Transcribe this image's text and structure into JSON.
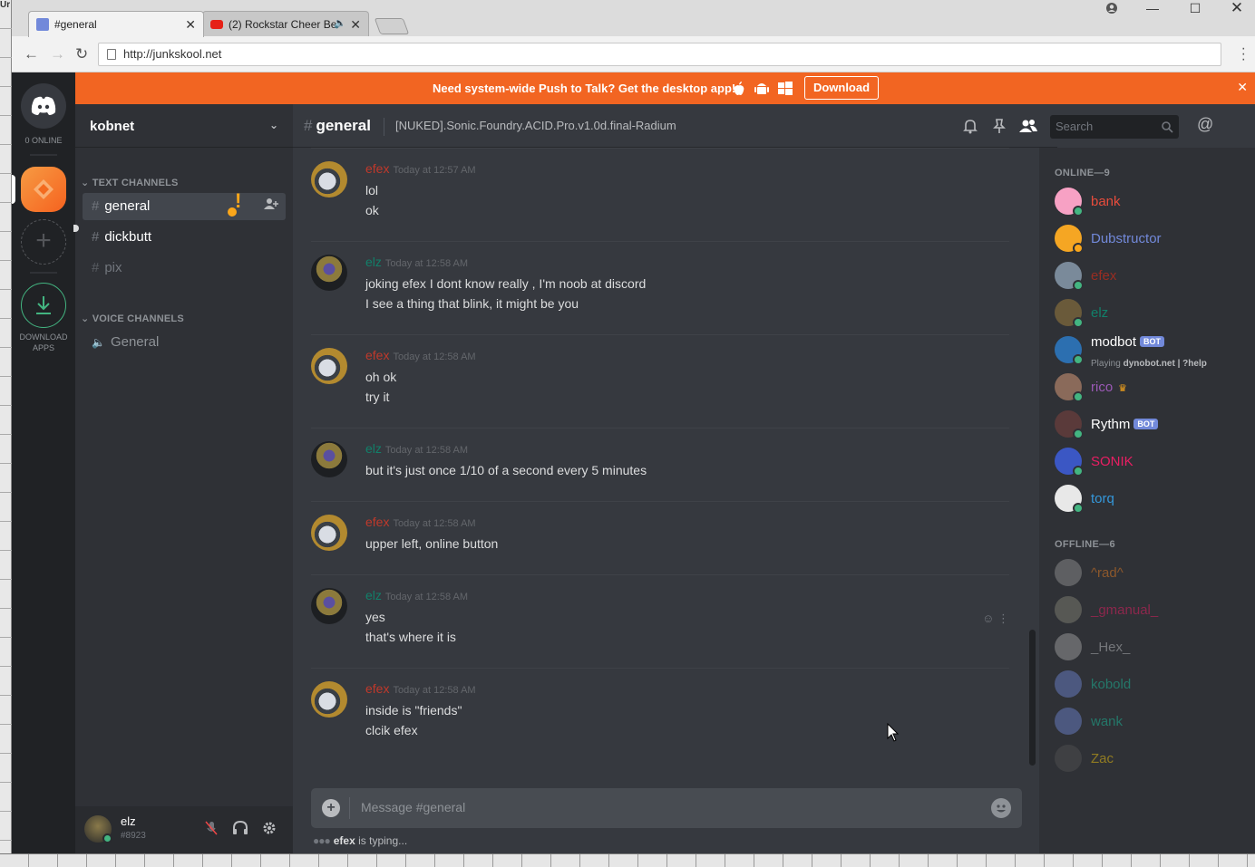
{
  "desktop": {
    "corner_text": "Ur"
  },
  "browser": {
    "tabs": [
      {
        "title": "#general",
        "active": true
      },
      {
        "title": "(2) Rockstar Cheer Be",
        "active": false
      }
    ],
    "url": "http://junkskool.net"
  },
  "banner": {
    "text": "Need system-wide Push to Talk? Get the desktop app!",
    "download_label": "Download"
  },
  "guilds": {
    "online_count": "0 ONLINE",
    "download_apps_label": "DOWNLOAD APPS"
  },
  "server": {
    "name": "kobnet",
    "text_channels_label": "TEXT CHANNELS",
    "voice_channels_label": "VOICE CHANNELS",
    "text_channels": [
      "general",
      "dickbutt",
      "pix"
    ],
    "voice_channels": [
      "General"
    ]
  },
  "user": {
    "name": "elz",
    "tag": "#8923"
  },
  "chat": {
    "channel_name": "general",
    "topic": "[NUKED].Sonic.Foundry.ACID.Pro.v1.0d.final-Radium",
    "search_placeholder": "Search",
    "composer_placeholder": "Message #general",
    "typing_user": "efex",
    "typing_suffix": "is typing...",
    "messages": [
      {
        "author": "efex",
        "color": "#c0392b",
        "time": "Today at 12:57 AM",
        "lines": [
          "lol",
          "ok"
        ]
      },
      {
        "author": "elz",
        "color": "#11806a",
        "time": "Today at 12:58 AM",
        "lines": [
          "joking efex I dont know really , I'm noob at discord",
          "I see a thing that blink, it might be you"
        ]
      },
      {
        "author": "efex",
        "color": "#c0392b",
        "time": "Today at 12:58 AM",
        "lines": [
          "oh ok",
          "try it"
        ]
      },
      {
        "author": "elz",
        "color": "#11806a",
        "time": "Today at 12:58 AM",
        "lines": [
          "but it's just once 1/10 of a second every 5 minutes"
        ]
      },
      {
        "author": "efex",
        "color": "#c0392b",
        "time": "Today at 12:58 AM",
        "lines": [
          "upper left, online button"
        ]
      },
      {
        "author": "elz",
        "color": "#11806a",
        "time": "Today at 12:58 AM",
        "lines": [
          "yes",
          "that's where it is"
        ]
      },
      {
        "author": "efex",
        "color": "#c0392b",
        "time": "Today at 12:58 AM",
        "lines": [
          "inside is \"friends\"",
          "clcik efex"
        ]
      }
    ]
  },
  "members": {
    "online_label": "ONLINE—9",
    "offline_label": "OFFLINE—6",
    "online": [
      {
        "name": "bank",
        "color": "#e74c3c",
        "status": "#43b581"
      },
      {
        "name": "Dubstructor",
        "color": "#7289da",
        "status": "#faa61a"
      },
      {
        "name": "efex",
        "color": "#992d22",
        "status": "#43b581"
      },
      {
        "name": "elz",
        "color": "#11806a",
        "status": "#43b581"
      },
      {
        "name": "modbot",
        "color": "#ffffff",
        "status": "#43b581",
        "bot": "BOT",
        "activity_prefix": "Playing",
        "activity": "dynobot.net | ?help"
      },
      {
        "name": "rico",
        "color": "#9b59b6",
        "status": "#43b581",
        "owner": true
      },
      {
        "name": "Rythm",
        "color": "#ffffff",
        "status": "#43b581",
        "bot": "BOT"
      },
      {
        "name": "SONIK",
        "color": "#e91e63",
        "status": "#43b581"
      },
      {
        "name": "torq",
        "color": "#3498db",
        "status": "#43b581"
      }
    ],
    "offline": [
      {
        "name": "^rad^",
        "color": "#e67e22"
      },
      {
        "name": "_gmanual_",
        "color": "#e91e63"
      },
      {
        "name": "_Hex_",
        "color": "#b9bbbe"
      },
      {
        "name": "kobold",
        "color": "#1abc9c"
      },
      {
        "name": "wank",
        "color": "#1abc9c"
      },
      {
        "name": "Zac",
        "color": "#f1c40f"
      }
    ]
  }
}
